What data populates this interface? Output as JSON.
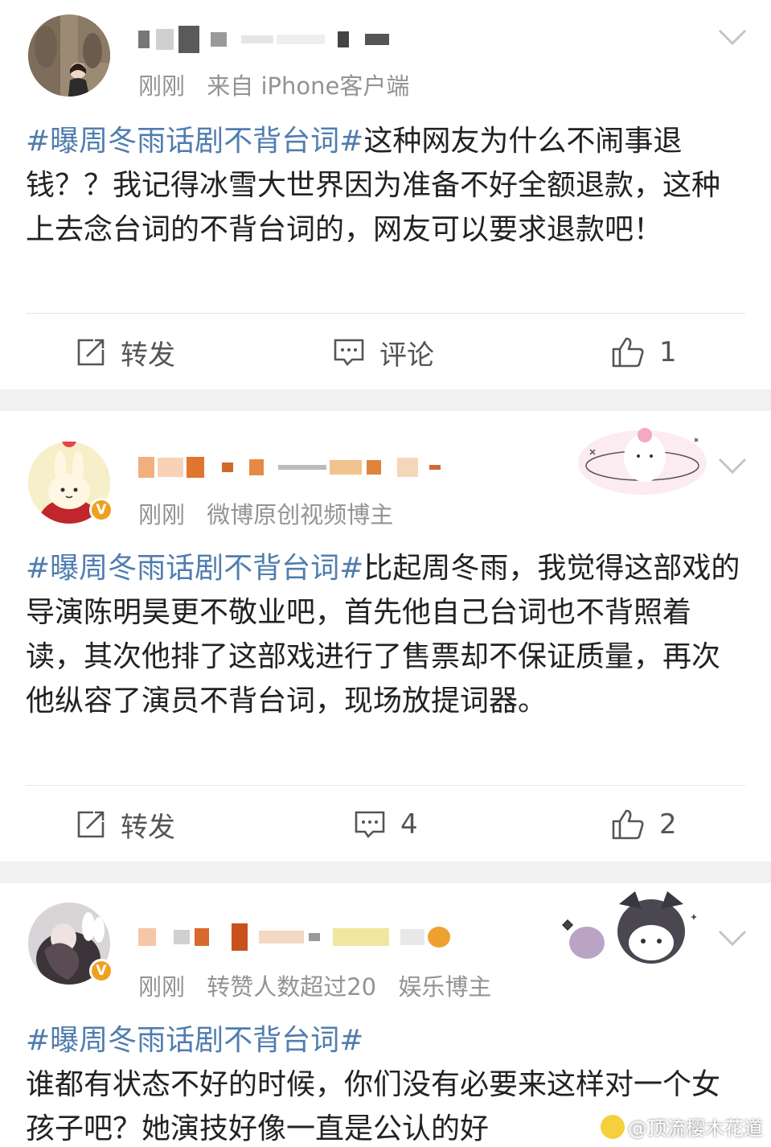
{
  "posts": [
    {
      "time": "刚刚",
      "source": "来自 iPhone客户端",
      "hashtag": "#曝周冬雨话剧不背台词#",
      "text": "这种网友为什么不闹事退钱？？我记得冰雪大世界因为准备不好全额退款，这种上去念台词的不背台词的，网友可以要求退款吧！",
      "repost_label": "转发",
      "comment_label": "评论",
      "like_count": "1"
    },
    {
      "time": "刚刚",
      "source": "微博原创视频博主",
      "verified": "V",
      "hashtag": "#曝周冬雨话剧不背台词#",
      "text": "比起周冬雨，我觉得这部戏的导演陈明昊更不敬业吧，首先他自己台词也不背照着读，其次他排了这部戏进行了售票却不保证质量，再次他纵容了演员不背台词，现场放提词器。",
      "repost_label": "转发",
      "comment_label": "4",
      "like_count": "2"
    },
    {
      "time": "刚刚",
      "source": "转赞人数超过20",
      "source2": "娱乐博主",
      "verified": "V",
      "hashtag": "#曝周冬雨话剧不背台词#",
      "text": "谁都有状态不好的时候，你们没有必要来这样对一个女孩子吧？她演技好像一直是公认的好"
    }
  ],
  "watermark": "@顶流樱木花道",
  "icons": [
    "chevron-down-icon",
    "repost-icon",
    "comment-icon",
    "like-icon",
    "verified-badge"
  ],
  "colors": {
    "hashtag": "#507daf",
    "meta": "#939393",
    "badge": "#f0a020",
    "separator": "#f1f1f1"
  }
}
